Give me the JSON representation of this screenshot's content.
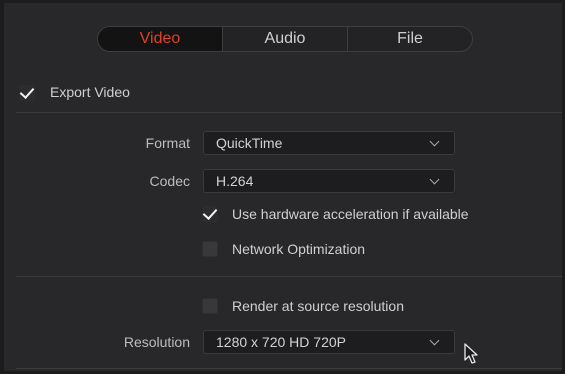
{
  "tabs": [
    {
      "label": "Video",
      "active": true
    },
    {
      "label": "Audio",
      "active": false
    },
    {
      "label": "File",
      "active": false
    }
  ],
  "export_video": {
    "label": "Export Video",
    "checked": true
  },
  "format": {
    "label": "Format",
    "value": "QuickTime"
  },
  "codec": {
    "label": "Codec",
    "value": "H.264"
  },
  "hw_accel": {
    "label": "Use hardware acceleration if available",
    "checked": true
  },
  "network_opt": {
    "label": "Network Optimization",
    "checked": false
  },
  "render_source": {
    "label": "Render at source resolution",
    "checked": false
  },
  "resolution": {
    "label": "Resolution",
    "value": "1280 x 720 HD 720P"
  },
  "colors": {
    "active_tab": "#e0412c",
    "panel_bg": "#28282a",
    "field_bg": "#1d1d1f"
  }
}
